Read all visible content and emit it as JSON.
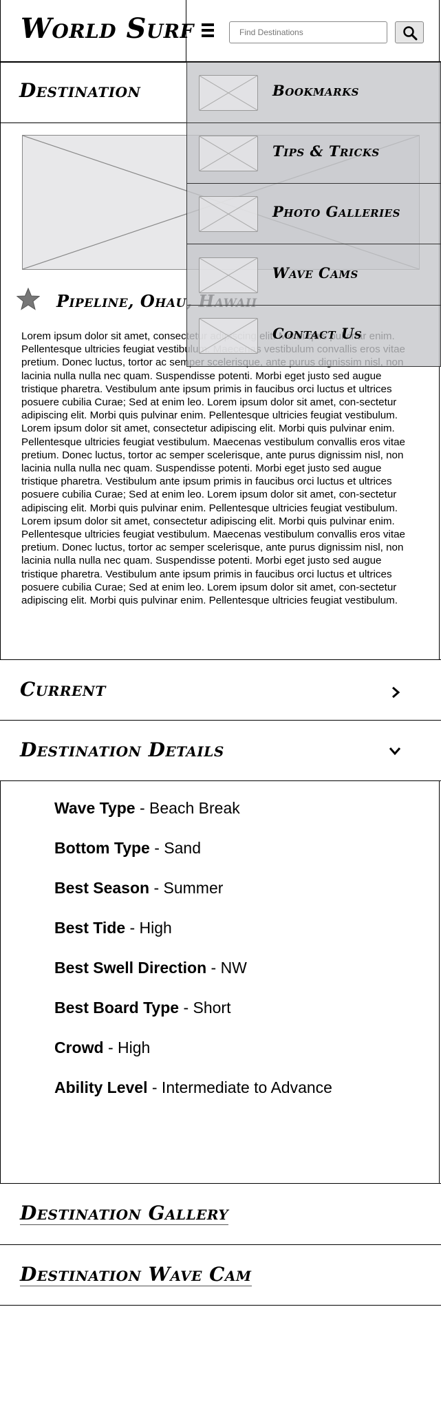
{
  "header": {
    "logo": "World Surf",
    "search_placeholder": "Find Destinations",
    "menu_icon": "hamburger-menu-icon",
    "search_icon": "magnifier-icon"
  },
  "menu": {
    "items": [
      {
        "label": "Bookmarks"
      },
      {
        "label": "Tips & Tricks"
      },
      {
        "label": "Photo Galleries"
      },
      {
        "label": "Wave Cams"
      },
      {
        "label": "Contact Us"
      }
    ]
  },
  "destination": {
    "heading": "Destination",
    "location": "Pipeline, Ohau, Hawaii",
    "paragraphs": [
      "Lorem ipsum dolor sit amet, consectetur adipiscing elit. Morbi quis pulvinar enim. Pellentesque ultricies feugiat vestibulum. Maecenas vestibulum convallis eros vitae pretium. Donec luctus, tortor ac semper scelerisque, ante purus dignissim nisl, non lacinia nulla nulla nec quam. Suspendisse potenti. Morbi eget justo sed augue tristique pharetra. Vestibulum ante ipsum primis in faucibus orci luctus et ultrices posuere cubilia Curae; Sed at enim leo. Lorem ipsum dolor sit amet, con-sectetur adipiscing elit. Morbi quis pulvinar enim. Pellentesque ultricies feugiat vestibulum.",
      "Lorem ipsum dolor sit amet, consectetur adipiscing elit. Morbi quis pulvinar enim. Pellentesque ultricies feugiat vestibulum. Maecenas vestibulum convallis eros vitae pretium. Donec luctus, tortor ac semper scelerisque, ante purus dignissim nisl, non lacinia nulla nulla nec quam. Suspendisse potenti. Morbi eget justo sed augue tristique pharetra. Vestibulum ante ipsum primis in faucibus orci luctus et ultrices posuere cubilia Curae; Sed at enim leo. Lorem ipsum dolor sit amet, con-sectetur adipiscing elit. Morbi quis pulvinar enim. Pellentesque ultricies feugiat vestibulum.",
      "Lorem ipsum dolor sit amet, consectetur adipiscing elit. Morbi quis pulvinar enim. Pellentesque ultricies feugiat vestibulum. Maecenas vestibulum convallis eros vitae pretium. Donec luctus, tortor ac semper scelerisque, ante purus dignissim nisl, non lacinia nulla nulla nec quam. Suspendisse potenti. Morbi eget justo sed augue tristique pharetra. Vestibulum ante ipsum primis in faucibus orci luctus et ultrices posuere cubilia Curae; Sed at enim leo. Lorem ipsum dolor sit amet, con-sectetur adipiscing elit. Morbi quis pulvinar enim. Pellentesque ultricies feugiat vestibulum."
    ]
  },
  "sections": {
    "current": {
      "title": "Current",
      "icon": "chevron-right-icon"
    },
    "details": {
      "title": "Destination Details",
      "icon": "chevron-down-icon",
      "items": [
        {
          "label": "Wave Type",
          "value": " - Beach Break"
        },
        {
          "label": "Bottom Type",
          "value": " - Sand"
        },
        {
          "label": "Best Season",
          "value": " - Summer"
        },
        {
          "label": "Best Tide",
          "value": " - High"
        },
        {
          "label": "Best Swell Direction",
          "value": " - NW"
        },
        {
          "label": "Best Board Type",
          "value": " - Short"
        },
        {
          "label": "Crowd",
          "value": " - High"
        },
        {
          "label": "Ability Level",
          "value": " - Intermediate to Advance"
        }
      ]
    },
    "gallery": {
      "title": "Destination Gallery"
    },
    "wavecam": {
      "title": "Destination Wave Cam"
    }
  },
  "colors": {
    "menu_overlay": "#c4c5c9",
    "placeholder_fill": "#e8e8ea",
    "star": "#777777"
  }
}
